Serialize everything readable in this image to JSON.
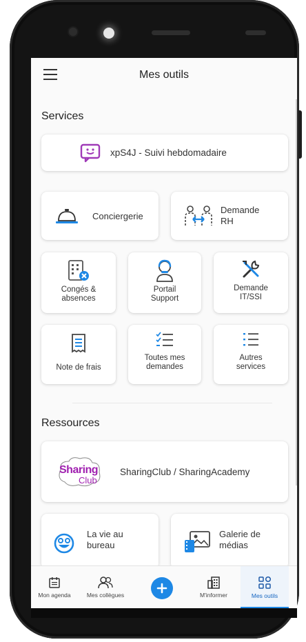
{
  "header": {
    "title": "Mes outils"
  },
  "sections": {
    "services": "Services",
    "resources": "Ressources"
  },
  "services": {
    "xps4j": "xpS4J - Suivi hebdomadaire",
    "conciergerie": "Conciergerie",
    "demande_rh": [
      "Demande",
      "RH"
    ],
    "conges": [
      "Congés &",
      "absences"
    ],
    "portail": [
      "Portail",
      "Support"
    ],
    "demande_it": [
      "Demande",
      "IT/SSI"
    ],
    "note_frais": "Note de frais",
    "toutes": [
      "Toutes mes",
      "demandes"
    ],
    "autres": [
      "Autres",
      "services"
    ]
  },
  "resources": {
    "sharing_logo_top": "Sharing",
    "sharing_logo_bottom": "Club",
    "sharing": "SharingClub / SharingAcademy",
    "vie": [
      "La vie au",
      "bureau"
    ],
    "galerie": [
      "Galerie de",
      "médias"
    ]
  },
  "nav": {
    "agenda": "Mon agenda",
    "collegues": "Mes collègues",
    "informer": "M'informer",
    "outils": "Mes outils"
  },
  "colors": {
    "accent": "#1e88e5",
    "purple": "#9c27b0",
    "blue_icon": "#1e88e5"
  }
}
